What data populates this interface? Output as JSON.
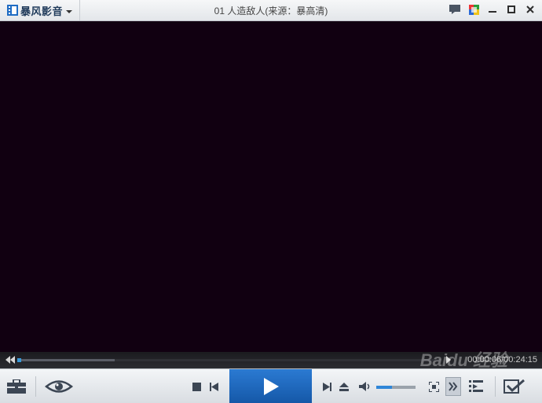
{
  "app": {
    "name": "暴风影音"
  },
  "window": {
    "title": "01 人造敌人(来源：暴高清)"
  },
  "player": {
    "time_display": "00:00:06/00:24:15",
    "progress_fraction": 0.23,
    "volume_fraction": 0.4
  },
  "icons": {
    "logo": "film-strip-icon",
    "chat": "chat-icon",
    "skin": "palette-icon",
    "minimize": "minimize-icon",
    "maximize": "maximize-icon",
    "close": "close-icon",
    "toolbox": "toolbox-icon",
    "eye": "eye-icon",
    "stop": "stop-icon",
    "prev": "previous-icon",
    "play": "play-icon",
    "next": "next-icon",
    "eject": "eject-icon",
    "volume": "speaker-icon",
    "fullscreen": "fullscreen-icon",
    "more": "double-chevron-icon",
    "playlist": "playlist-icon",
    "check": "checklist-icon"
  },
  "colors": {
    "accent": "#1f6cc4",
    "video_bg": "#110011"
  },
  "watermark": "Baidu 经验"
}
